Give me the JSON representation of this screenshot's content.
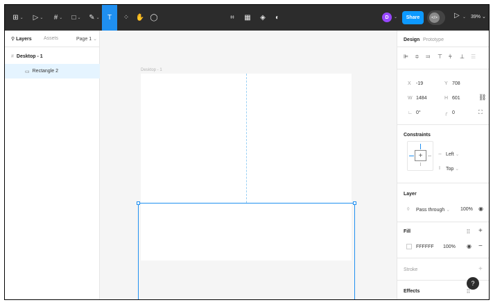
{
  "toolbar": {
    "tools": [
      {
        "name": "main-menu",
        "glyph": "⊞"
      },
      {
        "name": "move-tool",
        "glyph": "▷"
      },
      {
        "name": "frame-tool",
        "glyph": "#"
      },
      {
        "name": "shape-tool",
        "glyph": "□"
      },
      {
        "name": "pen-tool",
        "glyph": "✎"
      },
      {
        "name": "text-tool",
        "glyph": "T"
      },
      {
        "name": "resources-tool",
        "glyph": "⁘"
      },
      {
        "name": "hand-tool",
        "glyph": "✋"
      },
      {
        "name": "comment-tool",
        "glyph": "◯"
      }
    ],
    "center_tools": [
      {
        "name": "crop-icon",
        "glyph": "⌗"
      },
      {
        "name": "grid-icon",
        "glyph": "▦"
      },
      {
        "name": "component-icon",
        "glyph": "◈"
      },
      {
        "name": "contrast-icon",
        "glyph": "◐"
      }
    ],
    "avatar_initial": "D",
    "share_label": "Share",
    "dev_mode_glyph": "</>",
    "zoom": "39%",
    "caret": "⌄"
  },
  "left_panel": {
    "tab_layers": "Layers",
    "tab_assets": "Assets",
    "page": "Page 1",
    "layers": [
      {
        "name": "Desktop - 1",
        "icon": "frame-icon",
        "glyph": "#"
      },
      {
        "name": "Rectangle 2",
        "icon": "rectangle-icon",
        "glyph": "▭"
      }
    ]
  },
  "canvas": {
    "frame_label": "Desktop - 1"
  },
  "right_panel": {
    "tab_design": "Design",
    "tab_prototype": "Prototype",
    "x_label": "X",
    "x_value": "-19",
    "y_label": "Y",
    "y_value": "708",
    "w_label": "W",
    "w_value": "1484",
    "h_label": "H",
    "h_value": "601",
    "rotation_value": "0°",
    "radius_value": "0",
    "constraints_title": "Constraints",
    "constraint_h": "Left",
    "constraint_v": "Top",
    "layer_title": "Layer",
    "blend_mode": "Pass through",
    "layer_opacity": "100%",
    "fill_title": "Fill",
    "fill_hex": "FFFFFF",
    "fill_opacity": "100%",
    "stroke_title": "Stroke",
    "effects_title": "Effects",
    "help": "?"
  }
}
